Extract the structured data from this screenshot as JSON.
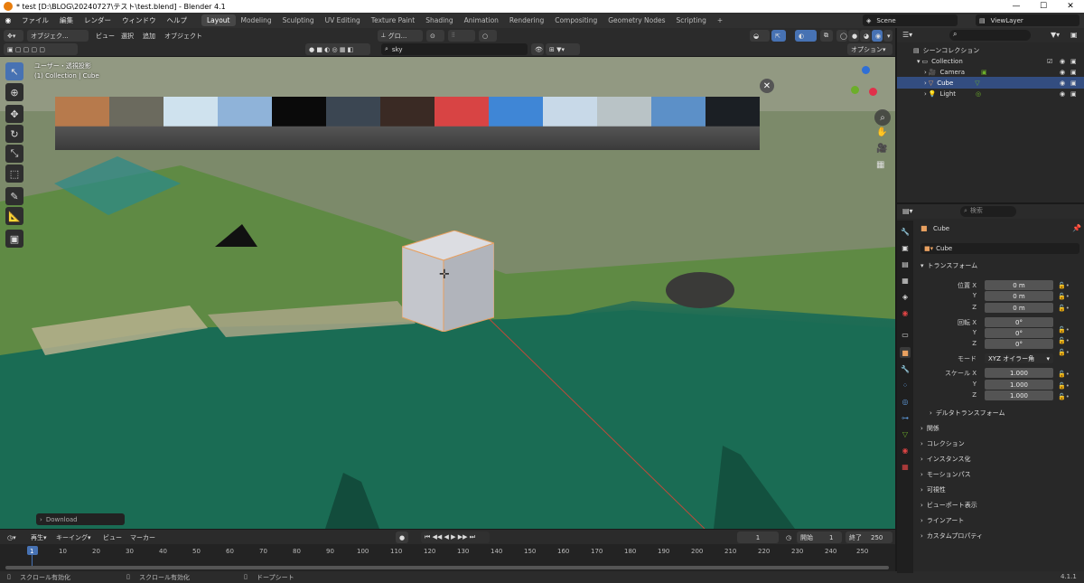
{
  "titlebar": {
    "title": "* test [D:\\BLOG\\20240727\\テスト\\test.blend] - Blender 4.1",
    "minimize": "—",
    "maximize": "☐",
    "close": "✕"
  },
  "menu": [
    "ファイル",
    "編集",
    "レンダー",
    "ウィンドウ",
    "ヘルプ"
  ],
  "workspaces": [
    "Layout",
    "Modeling",
    "Sculpting",
    "UV Editing",
    "Texture Paint",
    "Shading",
    "Animation",
    "Rendering",
    "Compositing",
    "Geometry Nodes",
    "Scripting",
    "+"
  ],
  "scene": {
    "label": "Scene",
    "viewlayer": "ViewLayer"
  },
  "viewport_header": {
    "mode": "オブジェク...",
    "view": "ビュー",
    "select": "選択",
    "add": "追加",
    "object": "オブジェクト",
    "transform": "グロ...",
    "search_value": "sky",
    "options": "オプション"
  },
  "viewport": {
    "info_line1": "ユーザー・透視投影",
    "info_line2": "(1) Collection | Cube",
    "download_label": "Download"
  },
  "hdri_thumbs": [
    "#b77a4c",
    "#6b6a5e",
    "#cfe2ee",
    "#8fb3d9",
    "#0a0a0a",
    "#3b4652",
    "#3a2a24",
    "#d84444",
    "#3f86d6",
    "#c8d9e8",
    "#b9c3c6",
    "#5c90c8",
    "#1b1f24"
  ],
  "timeline_header": {
    "play": "再生",
    "keying": "キーイング",
    "view": "ビュー",
    "marker": "マーカー",
    "current_frame": "1",
    "start_label": "開始",
    "start": "1",
    "end_label": "終了",
    "end": "250"
  },
  "timeline_ticks": [
    "1",
    "10",
    "20",
    "30",
    "40",
    "50",
    "60",
    "70",
    "80",
    "90",
    "100",
    "110",
    "120",
    "130",
    "140",
    "150",
    "160",
    "170",
    "180",
    "190",
    "200",
    "210",
    "220",
    "230",
    "240",
    "250"
  ],
  "status": {
    "item1": "スクロール有効化",
    "item2": "スクロール有効化",
    "item3": "ドープシート",
    "version": "4.1.1"
  },
  "outliner": {
    "root": "シーンコレクション",
    "collection": "Collection",
    "items": [
      "Camera",
      "Cube",
      "Light"
    ]
  },
  "properties": {
    "search_placeholder": "検索",
    "object_name": "Cube",
    "data_name": "Cube",
    "transform_title": "トランスフォーム",
    "location_label": "位置 X",
    "loc": [
      "0 m",
      "0 m",
      "0 m"
    ],
    "rotation_label": "回転 X",
    "rot": [
      "0°",
      "0°",
      "0°"
    ],
    "mode_label": "モード",
    "mode_value": "XYZ オイラー角",
    "scale_label": "スケール X",
    "scale": [
      "1.000",
      "1.000",
      "1.000"
    ],
    "axis_y": "Y",
    "axis_z": "Z",
    "delta": "デルタトランスフォーム",
    "sections": [
      "関係",
      "コレクション",
      "インスタンス化",
      "モーションパス",
      "可視性",
      "ビューポート表示",
      "ラインアート",
      "カスタムプロパティ"
    ]
  }
}
